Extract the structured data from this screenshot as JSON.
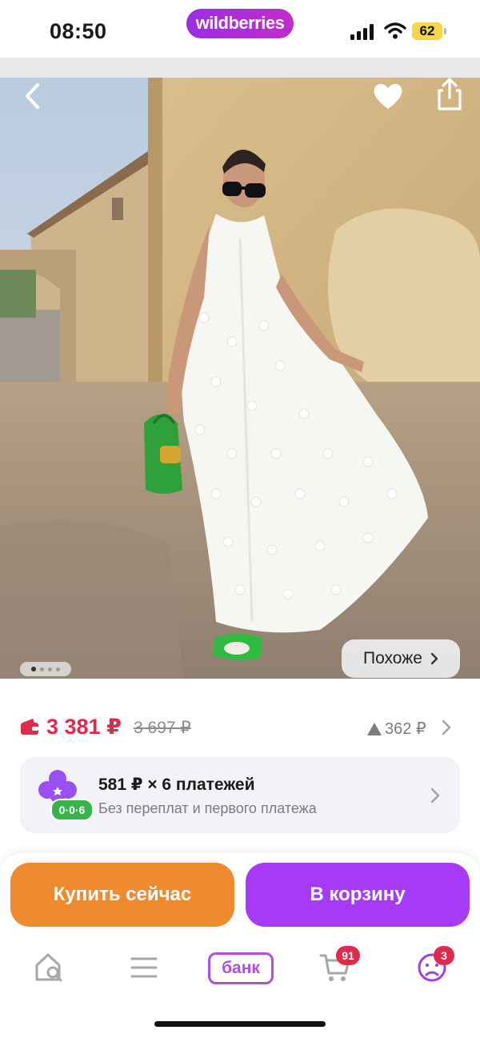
{
  "status_bar": {
    "time": "08:50",
    "brand": "wildberries",
    "battery": "62",
    "icons": [
      "cellular-signal-icon",
      "wifi-icon",
      "battery-icon"
    ]
  },
  "product": {
    "image_alt": "",
    "gallery": {
      "count": 4,
      "active_index": 0
    },
    "similar_label": "Похоже",
    "actions": [
      "back-icon",
      "heart-icon",
      "share-icon"
    ]
  },
  "price": {
    "current": "3 381 ₽",
    "old": "3 697 ₽",
    "rise": "362 ₽",
    "color_accent": "#e02a4c"
  },
  "installment": {
    "title": "581 ₽ × 6 платежей",
    "subtitle": "Без переплат и первого платежа",
    "badge": "0·0·6"
  },
  "actions": {
    "buy_now": "Купить сейчас",
    "add_to_cart": "В корзину",
    "buy_color": "#f08a2f",
    "cart_color": "#a73af6"
  },
  "tab_bar": {
    "bank_label": "банк",
    "cart_count": "91",
    "profile_count": "3",
    "icons": [
      "home-search-icon",
      "menu-icon",
      "bank-icon",
      "cart-icon",
      "profile-icon"
    ]
  }
}
